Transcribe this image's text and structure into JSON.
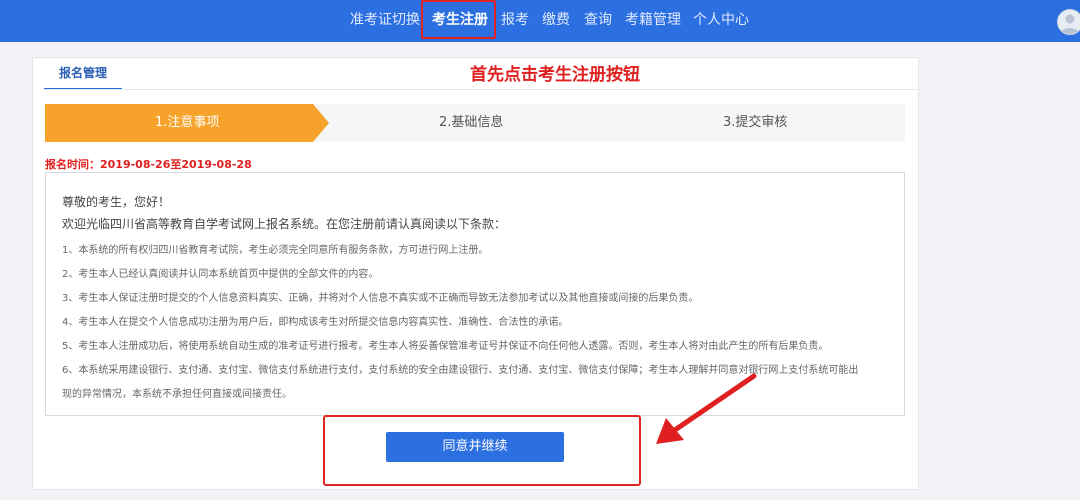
{
  "nav": {
    "items": [
      "准考证切换",
      "考生注册",
      "报考",
      "缴费",
      "查询",
      "考籍管理",
      "个人中心"
    ],
    "active": "考生注册"
  },
  "annotation": {
    "instruction": "首先点击考生注册按钮"
  },
  "card": {
    "tab_label": "报名管理",
    "steps": [
      "1.注意事项",
      "2.基础信息",
      "3.提交审核"
    ],
    "active_step": 1,
    "registration_time": "报名时间：2019-08-26至2019-08-28"
  },
  "notice": {
    "greeting": "尊敬的考生，您好！",
    "intro": "欢迎光临四川省高等教育自学考试网上报名系统。在您注册前请认真阅读以下条款：",
    "clauses": [
      "1、本系统的所有权归四川省教育考试院，考生必须完全同意所有服务条款，方可进行网上注册。",
      "2、考生本人已经认真阅读并认同本系统首页中提供的全部文件的内容。",
      "3、考生本人保证注册时提交的个人信息资料真实、正确，并将对个人信息不真实或不正确而导致无法参加考试以及其他直接或间接的后果负责。",
      "4、考生本人在提交个人信息成功注册为用户后，即构成该考生对所提交信息内容真实性、准确性、合法性的承诺。",
      "5、考生本人注册成功后，将使用系统自动生成的准考证号进行报考。考生本人将妥善保管准考证号并保证不向任何他人透露。否则，考生本人将对由此产生的所有后果负责。",
      "6、本系统采用建设银行、支付通、支付宝、微信支付系统进行支付，支付系统的安全由建设银行、支付通、支付宝、微信支付保障；考生本人理解并同意对银行网上支付系统可能出",
      "现的异常情况，本系统不承担任何直接或间接责任。"
    ]
  },
  "actions": {
    "agree_label": "同意并继续"
  },
  "colors": {
    "nav_bg": "#2c6fe0",
    "step_active": "#f7a22a",
    "annotation_red": "#e02020",
    "button_blue": "#2c6fe0"
  }
}
